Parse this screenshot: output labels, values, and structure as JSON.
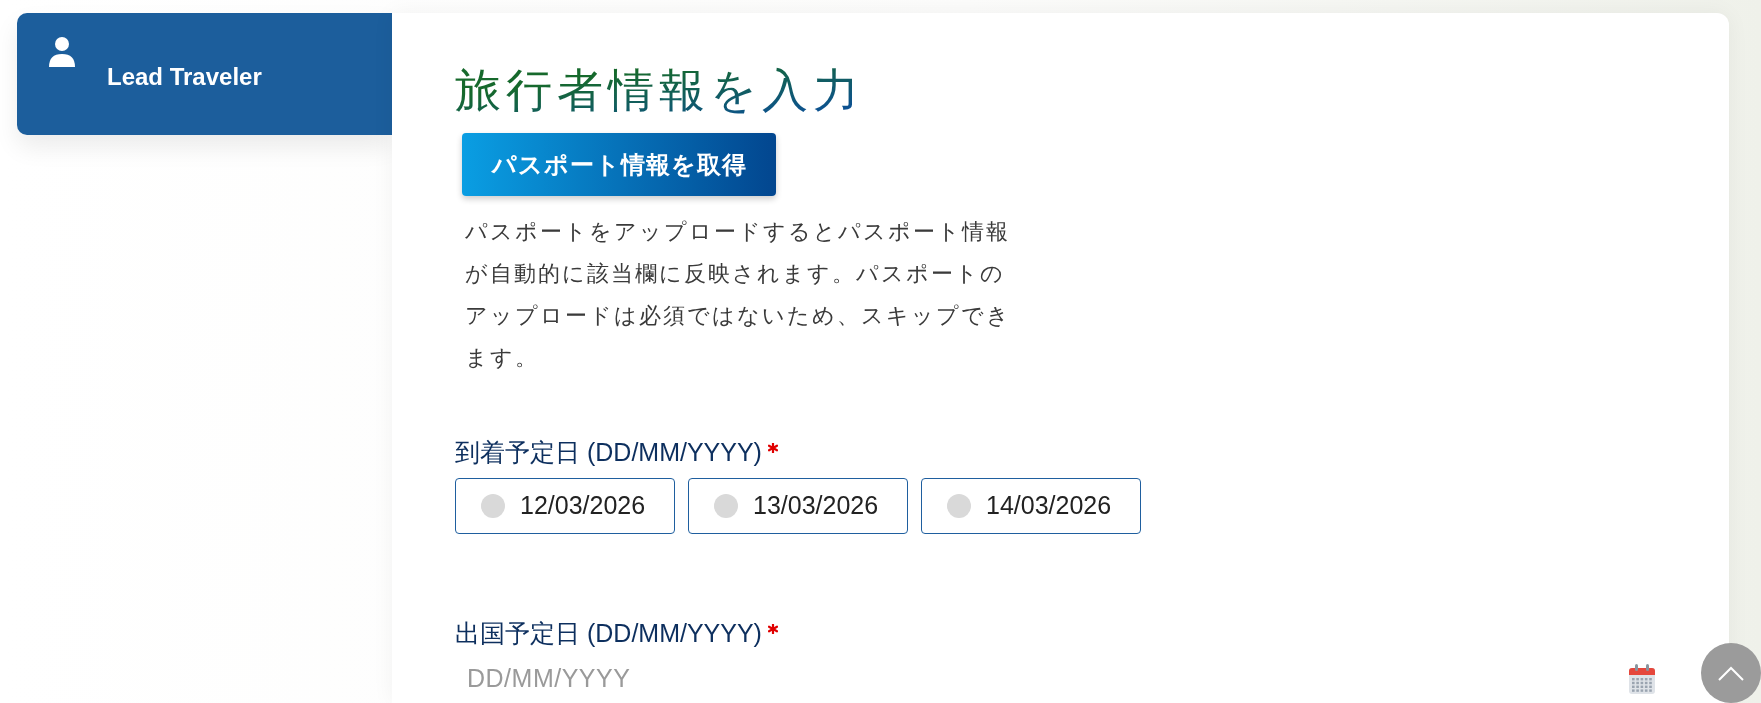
{
  "sidebar": {
    "items": [
      {
        "label": "Lead Traveler",
        "selected": true
      }
    ]
  },
  "form": {
    "title": "旅行者情報を入力",
    "passport_button": "パスポート情報を取得",
    "description": "パスポートをアップロードするとパスポート情報が自動的に該当欄に反映されます。パスポートのアップロードは必須ではないため、スキップできます。",
    "fields": [
      {
        "kind": "radio_group",
        "label": "到着予定日 (DD/MM/YYYY)",
        "required": true,
        "options": [
          {
            "label": "12/03/2026",
            "selected": false
          },
          {
            "label": "13/03/2026",
            "selected": false
          },
          {
            "label": "14/03/2026",
            "selected": false
          }
        ]
      },
      {
        "kind": "date_input",
        "label": "出国予定日 (DD/MM/YYYY)",
        "required": true,
        "placeholder": "DD/MM/YYYY"
      }
    ]
  }
}
